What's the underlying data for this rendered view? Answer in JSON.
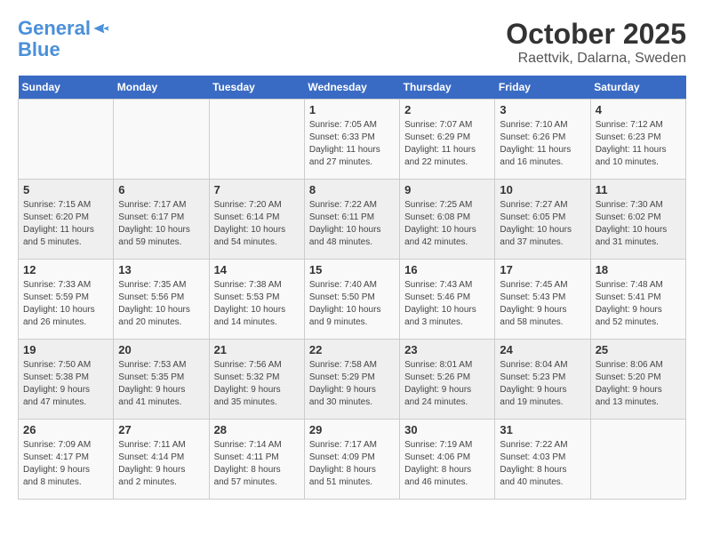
{
  "header": {
    "logo_line1": "General",
    "logo_line2": "Blue",
    "month": "October 2025",
    "location": "Raettvik, Dalarna, Sweden"
  },
  "weekdays": [
    "Sunday",
    "Monday",
    "Tuesday",
    "Wednesday",
    "Thursday",
    "Friday",
    "Saturday"
  ],
  "weeks": [
    [
      {
        "day": "",
        "info": ""
      },
      {
        "day": "",
        "info": ""
      },
      {
        "day": "",
        "info": ""
      },
      {
        "day": "1",
        "info": "Sunrise: 7:05 AM\nSunset: 6:33 PM\nDaylight: 11 hours\nand 27 minutes."
      },
      {
        "day": "2",
        "info": "Sunrise: 7:07 AM\nSunset: 6:29 PM\nDaylight: 11 hours\nand 22 minutes."
      },
      {
        "day": "3",
        "info": "Sunrise: 7:10 AM\nSunset: 6:26 PM\nDaylight: 11 hours\nand 16 minutes."
      },
      {
        "day": "4",
        "info": "Sunrise: 7:12 AM\nSunset: 6:23 PM\nDaylight: 11 hours\nand 10 minutes."
      }
    ],
    [
      {
        "day": "5",
        "info": "Sunrise: 7:15 AM\nSunset: 6:20 PM\nDaylight: 11 hours\nand 5 minutes."
      },
      {
        "day": "6",
        "info": "Sunrise: 7:17 AM\nSunset: 6:17 PM\nDaylight: 10 hours\nand 59 minutes."
      },
      {
        "day": "7",
        "info": "Sunrise: 7:20 AM\nSunset: 6:14 PM\nDaylight: 10 hours\nand 54 minutes."
      },
      {
        "day": "8",
        "info": "Sunrise: 7:22 AM\nSunset: 6:11 PM\nDaylight: 10 hours\nand 48 minutes."
      },
      {
        "day": "9",
        "info": "Sunrise: 7:25 AM\nSunset: 6:08 PM\nDaylight: 10 hours\nand 42 minutes."
      },
      {
        "day": "10",
        "info": "Sunrise: 7:27 AM\nSunset: 6:05 PM\nDaylight: 10 hours\nand 37 minutes."
      },
      {
        "day": "11",
        "info": "Sunrise: 7:30 AM\nSunset: 6:02 PM\nDaylight: 10 hours\nand 31 minutes."
      }
    ],
    [
      {
        "day": "12",
        "info": "Sunrise: 7:33 AM\nSunset: 5:59 PM\nDaylight: 10 hours\nand 26 minutes."
      },
      {
        "day": "13",
        "info": "Sunrise: 7:35 AM\nSunset: 5:56 PM\nDaylight: 10 hours\nand 20 minutes."
      },
      {
        "day": "14",
        "info": "Sunrise: 7:38 AM\nSunset: 5:53 PM\nDaylight: 10 hours\nand 14 minutes."
      },
      {
        "day": "15",
        "info": "Sunrise: 7:40 AM\nSunset: 5:50 PM\nDaylight: 10 hours\nand 9 minutes."
      },
      {
        "day": "16",
        "info": "Sunrise: 7:43 AM\nSunset: 5:46 PM\nDaylight: 10 hours\nand 3 minutes."
      },
      {
        "day": "17",
        "info": "Sunrise: 7:45 AM\nSunset: 5:43 PM\nDaylight: 9 hours\nand 58 minutes."
      },
      {
        "day": "18",
        "info": "Sunrise: 7:48 AM\nSunset: 5:41 PM\nDaylight: 9 hours\nand 52 minutes."
      }
    ],
    [
      {
        "day": "19",
        "info": "Sunrise: 7:50 AM\nSunset: 5:38 PM\nDaylight: 9 hours\nand 47 minutes."
      },
      {
        "day": "20",
        "info": "Sunrise: 7:53 AM\nSunset: 5:35 PM\nDaylight: 9 hours\nand 41 minutes."
      },
      {
        "day": "21",
        "info": "Sunrise: 7:56 AM\nSunset: 5:32 PM\nDaylight: 9 hours\nand 35 minutes."
      },
      {
        "day": "22",
        "info": "Sunrise: 7:58 AM\nSunset: 5:29 PM\nDaylight: 9 hours\nand 30 minutes."
      },
      {
        "day": "23",
        "info": "Sunrise: 8:01 AM\nSunset: 5:26 PM\nDaylight: 9 hours\nand 24 minutes."
      },
      {
        "day": "24",
        "info": "Sunrise: 8:04 AM\nSunset: 5:23 PM\nDaylight: 9 hours\nand 19 minutes."
      },
      {
        "day": "25",
        "info": "Sunrise: 8:06 AM\nSunset: 5:20 PM\nDaylight: 9 hours\nand 13 minutes."
      }
    ],
    [
      {
        "day": "26",
        "info": "Sunrise: 7:09 AM\nSunset: 4:17 PM\nDaylight: 9 hours\nand 8 minutes."
      },
      {
        "day": "27",
        "info": "Sunrise: 7:11 AM\nSunset: 4:14 PM\nDaylight: 9 hours\nand 2 minutes."
      },
      {
        "day": "28",
        "info": "Sunrise: 7:14 AM\nSunset: 4:11 PM\nDaylight: 8 hours\nand 57 minutes."
      },
      {
        "day": "29",
        "info": "Sunrise: 7:17 AM\nSunset: 4:09 PM\nDaylight: 8 hours\nand 51 minutes."
      },
      {
        "day": "30",
        "info": "Sunrise: 7:19 AM\nSunset: 4:06 PM\nDaylight: 8 hours\nand 46 minutes."
      },
      {
        "day": "31",
        "info": "Sunrise: 7:22 AM\nSunset: 4:03 PM\nDaylight: 8 hours\nand 40 minutes."
      },
      {
        "day": "",
        "info": ""
      }
    ]
  ]
}
